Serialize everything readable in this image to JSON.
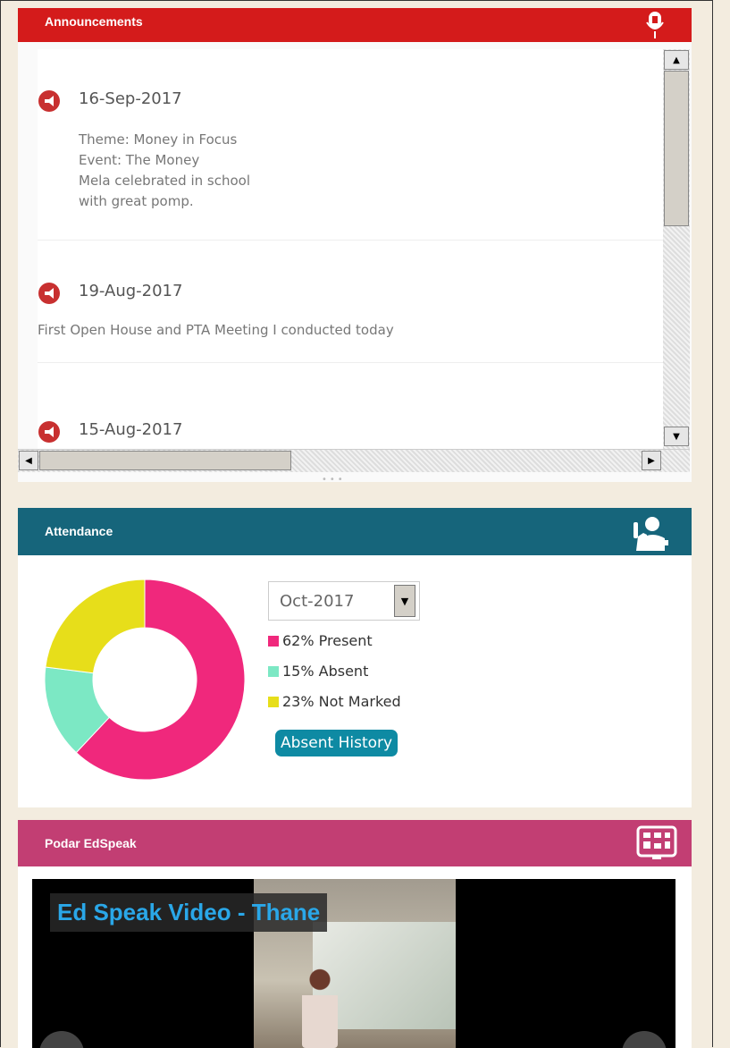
{
  "announcements": {
    "title": "Announcements",
    "items": [
      {
        "date": "16-Sep-2017",
        "lines": [
          "Theme: Money in Focus",
          "Event: The Money",
          "Mela celebrated in school",
          "with great pomp."
        ]
      },
      {
        "date": "19-Aug-2017",
        "lines": [
          "First Open House and PTA Meeting I conducted today"
        ]
      },
      {
        "date": "15-Aug-2017",
        "lines": []
      }
    ],
    "more_dots": "•••"
  },
  "attendance": {
    "title": "Attendance",
    "month_value": "Oct-2017",
    "legend": [
      {
        "label": "62% Present",
        "percent": 62,
        "color": "#f0287c"
      },
      {
        "label": "15% Absent",
        "percent": 15,
        "color": "#7ce8c4"
      },
      {
        "label": "23% Not Marked",
        "percent": 23,
        "color": "#e7de1a"
      }
    ],
    "absent_history_label": "Absent History"
  },
  "edspeak": {
    "title": "Podar EdSpeak",
    "video_title": "Ed Speak Video - Thane"
  },
  "colors": {
    "announcements_header": "#d41b1b",
    "attendance_header": "#16657b",
    "edspeak_header": "#c23e73"
  }
}
